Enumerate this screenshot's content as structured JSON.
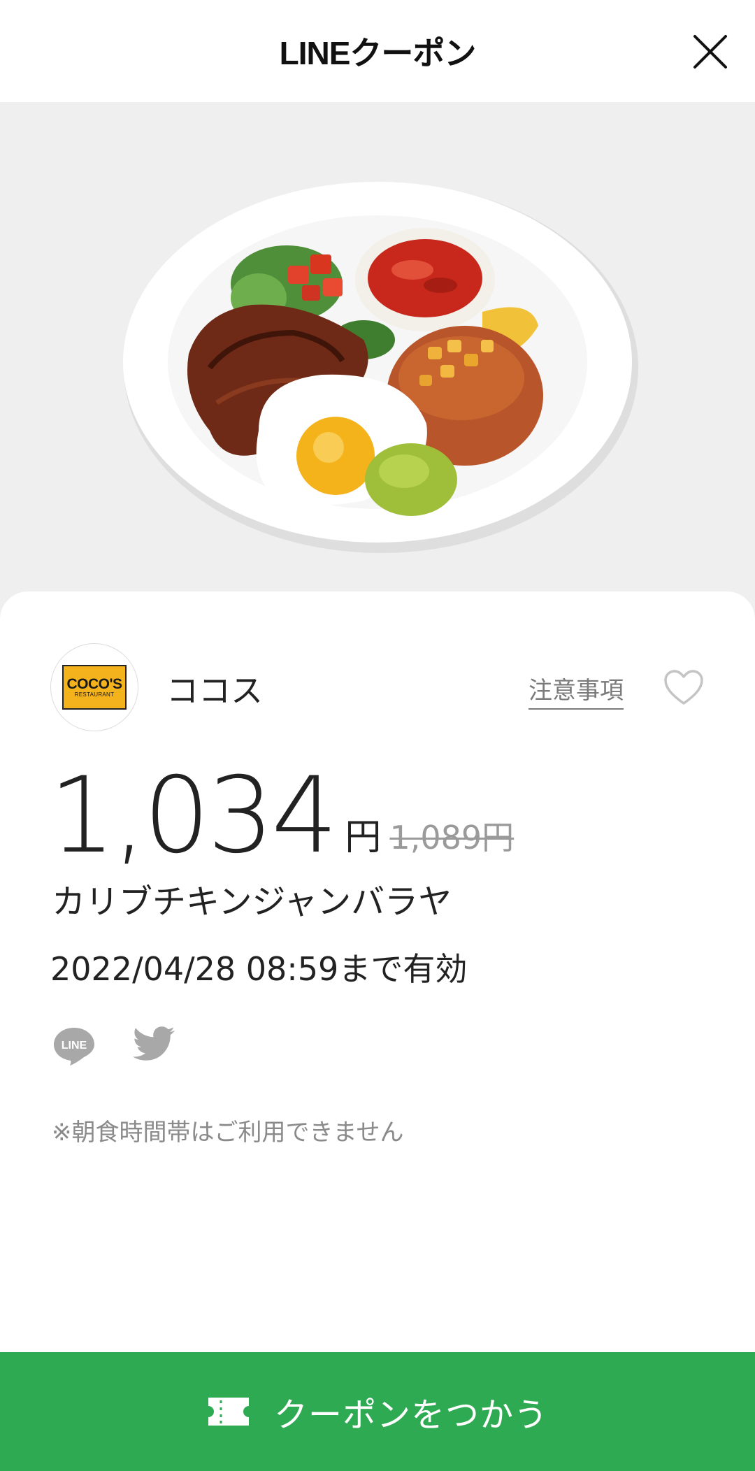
{
  "header": {
    "title": "LINEクーポン",
    "close_icon": "close-icon"
  },
  "store": {
    "name": "ココス",
    "logo_text": "COCO'S",
    "logo_subtext": "RESTAURANT",
    "notes_label": "注意事項",
    "favorite_icon": "heart-outline-icon"
  },
  "coupon": {
    "price": "1,034",
    "price_unit": "円",
    "original_price": "1,089円",
    "product_name": "カリブチキンジャンバラヤ",
    "validity": "2022/04/28  08:59まで有効",
    "notice": "※朝食時間帯はご利用できません"
  },
  "share": {
    "line_label": "LINE",
    "line_icon": "line-share-icon",
    "twitter_icon": "twitter-share-icon"
  },
  "cta": {
    "label": "クーポンをつかう",
    "icon": "ticket-icon"
  },
  "colors": {
    "accent_green": "#2eaa52",
    "hero_bg": "#efefef",
    "logo_yellow": "#f4b31c"
  }
}
